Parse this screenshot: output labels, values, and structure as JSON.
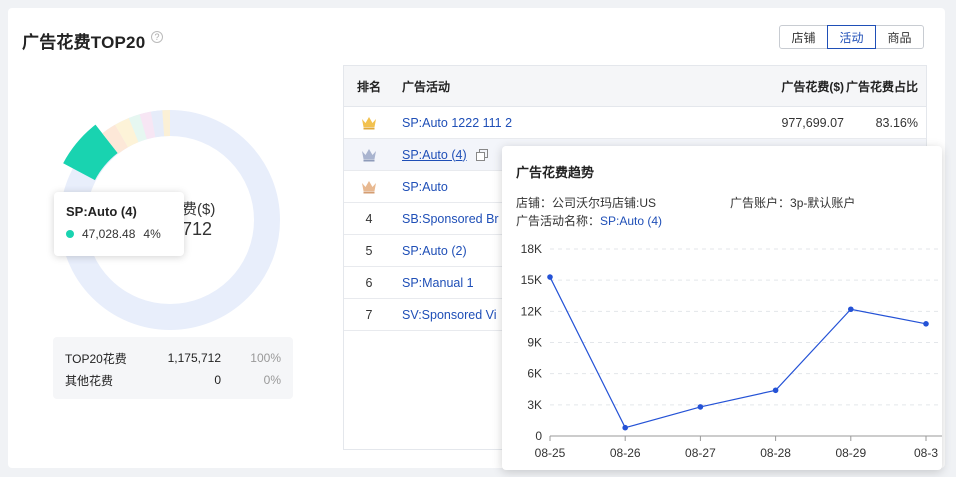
{
  "header": {
    "title": "广告花费TOP20",
    "help_icon": "?"
  },
  "tabs": [
    {
      "label": "店铺",
      "active": false
    },
    {
      "label": "活动",
      "active": true
    },
    {
      "label": "商品",
      "active": false
    }
  ],
  "donut": {
    "center_label": "费($)",
    "center_value": "712",
    "segment_colors": [
      "#e8eefb",
      "#19d3b0",
      "#fde8d8",
      "#fdf3d8",
      "#e6f7f1",
      "#f7e6f4",
      "#e6ecf9",
      "#fbf0d6"
    ],
    "highlighted_color": "#19d3b0"
  },
  "donut_tooltip": {
    "title": "SP:Auto (4)",
    "value": "47,028.48",
    "pct": "4%"
  },
  "summary": [
    {
      "label": "TOP20花费",
      "value": "1,175,712",
      "pct": "100%"
    },
    {
      "label": "其他花费",
      "value": "0",
      "pct": "0%"
    }
  ],
  "table": {
    "headers": {
      "rank": "排名",
      "campaign": "广告活动",
      "spend": "广告花费($)",
      "ratio": "广告花费占比"
    },
    "rows": [
      {
        "rank": "1",
        "campaign": "SP:Auto 1222 111 2",
        "spend": "977,699.07",
        "ratio": "83.16%"
      },
      {
        "rank": "2",
        "campaign": "SP:Auto (4)",
        "spend": "",
        "ratio": ""
      },
      {
        "rank": "3",
        "campaign": "SP:Auto",
        "spend": "",
        "ratio": ""
      },
      {
        "rank": "4",
        "campaign": "SB:Sponsored Br",
        "spend": "",
        "ratio": ""
      },
      {
        "rank": "5",
        "campaign": "SP:Auto (2)",
        "spend": "",
        "ratio": ""
      },
      {
        "rank": "6",
        "campaign": "SP:Manual 1",
        "spend": "",
        "ratio": ""
      },
      {
        "rank": "7",
        "campaign": "SV:Sponsored Vi",
        "spend": "",
        "ratio": ""
      }
    ],
    "crown_colors": [
      "#f2c14e",
      "#9eabc9",
      "#e7b48a"
    ]
  },
  "trend_tooltip": {
    "title": "广告花费趋势",
    "store_label": "店铺：",
    "store_value": "公司沃尔玛店铺:US",
    "account_label": "广告账户：",
    "account_value": "3p-默认账户",
    "campaign_label": "广告活动名称：",
    "campaign_value": "SP:Auto (4)"
  },
  "chart_data": {
    "type": "line",
    "x": [
      "08-25",
      "08-26",
      "08-27",
      "08-28",
      "08-29",
      "08-30"
    ],
    "x_tick_labels": [
      "08-25",
      "08-26",
      "08-27",
      "08-28",
      "08-29",
      "08-3"
    ],
    "values": [
      15300,
      800,
      2800,
      4400,
      12200,
      10800
    ],
    "y_ticks": [
      "0",
      "3K",
      "6K",
      "9K",
      "12K",
      "15K",
      "18K"
    ],
    "ylim": [
      0,
      18000
    ],
    "grid": true,
    "line_color": "#2452d6"
  }
}
